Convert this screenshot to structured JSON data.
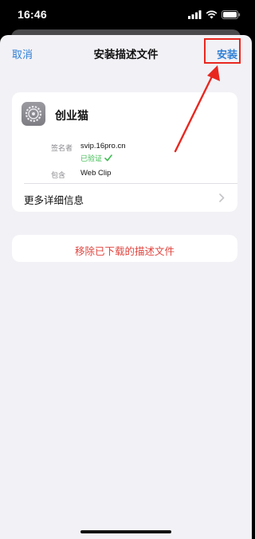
{
  "status_bar": {
    "time": "16:46",
    "icons": [
      "signal-icon",
      "wifi-icon",
      "battery-icon"
    ]
  },
  "nav": {
    "cancel_label": "取消",
    "title": "安装描述文件",
    "install_label": "安装"
  },
  "profile": {
    "name": "创业猫",
    "icon": "settings-gear-icon",
    "signer_label": "签名者",
    "signer_value": "svip.16pro.cn",
    "verified_label": "已验证",
    "contains_label": "包含",
    "contains_value": "Web Clip",
    "more_details_label": "更多详细信息"
  },
  "remove": {
    "label": "移除已下载的描述文件"
  },
  "colors": {
    "accent": "#2f80d6",
    "annotation": "#e8271f",
    "verified": "#3dbb50",
    "destructive": "#e0453f",
    "background": "#f2f1f6"
  }
}
